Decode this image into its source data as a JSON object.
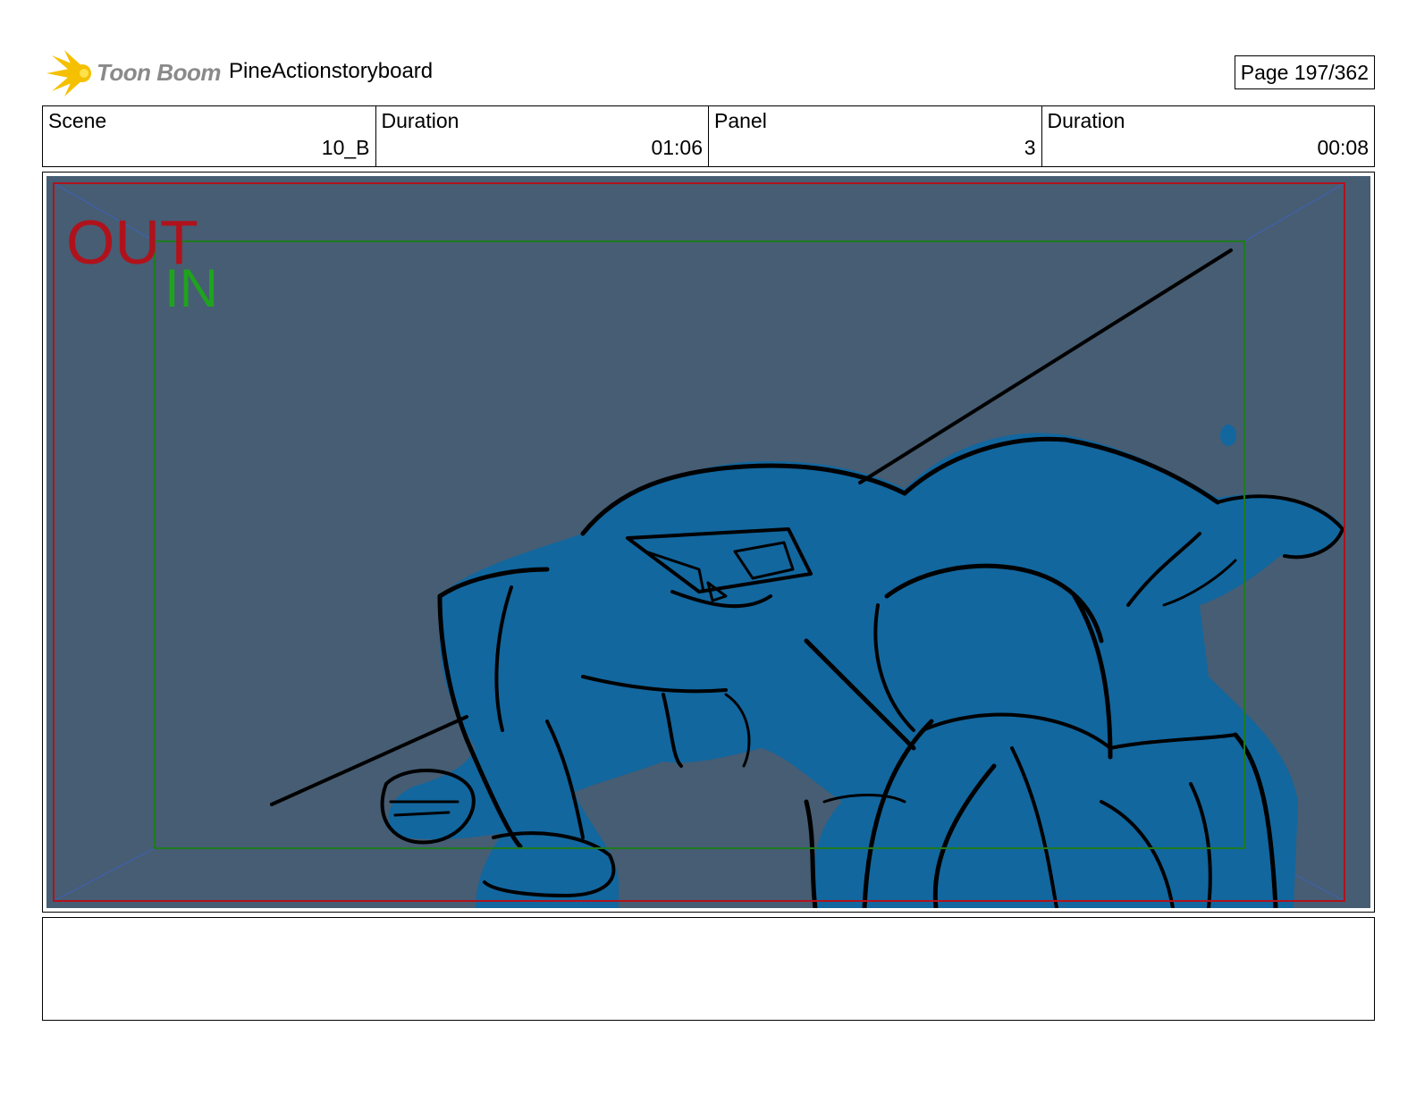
{
  "header": {
    "brand": "Toon Boom",
    "project_title": "PineActionstoryboard",
    "page_label": "Page 197/362"
  },
  "info": [
    {
      "label": "Scene",
      "value": "10_B"
    },
    {
      "label": "Duration",
      "value": "01:06"
    },
    {
      "label": "Panel",
      "value": "3"
    },
    {
      "label": "Duration",
      "value": "00:08"
    }
  ],
  "panel": {
    "frame_out_label": "OUT",
    "frame_in_label": "IN",
    "colors": {
      "background": "#465d73",
      "fill": "#12679f",
      "out_frame": "#b0121c",
      "in_frame": "#1f7a1f",
      "perspective": "#4060b0"
    }
  },
  "notes": ""
}
